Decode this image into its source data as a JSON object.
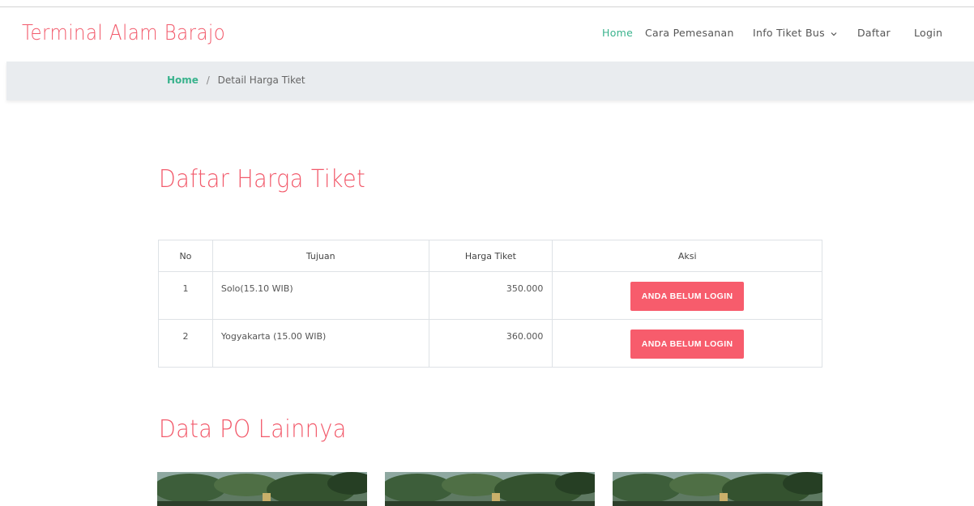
{
  "header": {
    "logo": "Terminal Alam Barajo",
    "nav": [
      {
        "label": "Home",
        "active": true
      },
      {
        "label": "Cara Pemesanan",
        "active": false
      },
      {
        "label": "Info Tiket Bus",
        "active": false,
        "dropdown": true
      },
      {
        "label": "Daftar",
        "active": false
      },
      {
        "label": "Login",
        "active": false
      }
    ]
  },
  "breadcrumb": {
    "home": "Home",
    "separator": "/",
    "current": "Detail Harga Tiket"
  },
  "prices": {
    "title": "Daftar Harga Tiket",
    "columns": [
      "No",
      "Tujuan",
      "Harga Tiket",
      "Aksi"
    ],
    "rows": [
      {
        "no": "1",
        "tujuan": "Solo(15.10 WIB)",
        "harga": "350.000",
        "aksi": "ANDA BELUM LOGIN"
      },
      {
        "no": "2",
        "tujuan": "Yogyakarta (15.00 WIB)",
        "harga": "360.000",
        "aksi": "ANDA BELUM LOGIN"
      }
    ]
  },
  "po": {
    "title": "Data PO Lainnya",
    "cards": [
      "bus-photo",
      "bus-photo",
      "bus-photo"
    ]
  },
  "colors": {
    "accent": "#f25a6b",
    "nav_active": "#3ab38d",
    "button": "#f75c6c",
    "breadcrumb_bg": "#e9ecef"
  }
}
